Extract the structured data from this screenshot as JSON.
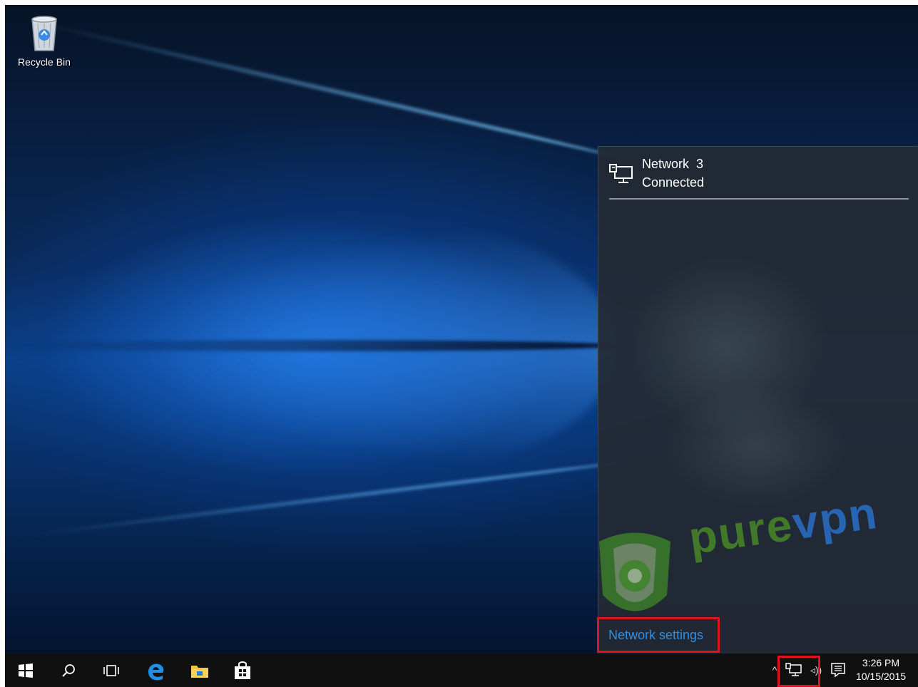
{
  "desktop": {
    "icons": [
      {
        "label": "Recycle Bin",
        "icon": "recycle-bin-icon"
      }
    ]
  },
  "network_flyout": {
    "network": {
      "icon": "ethernet-monitor-icon",
      "name": "Network  3",
      "status": "Connected"
    },
    "settings_link": "Network settings"
  },
  "watermark": {
    "text_part1": "pure",
    "text_part2": "vpn",
    "logo": "purevpn-shield-logo"
  },
  "taskbar": {
    "buttons": [
      {
        "name": "Start",
        "icon": "windows-logo-icon"
      },
      {
        "name": "Search",
        "icon": "search-icon"
      },
      {
        "name": "Task View",
        "icon": "task-view-icon"
      },
      {
        "name": "Microsoft Edge",
        "icon": "edge-icon"
      },
      {
        "name": "File Explorer",
        "icon": "folder-icon"
      },
      {
        "name": "Store",
        "icon": "store-bag-icon"
      }
    ],
    "tray": {
      "chevron": "^",
      "volume": "◃))",
      "time": "3:26 PM",
      "date": "10/15/2015"
    }
  },
  "colors": {
    "highlight": "#e0141e",
    "link": "#2d8fe6",
    "taskbar": "#101010",
    "flyout": "#232a34"
  }
}
